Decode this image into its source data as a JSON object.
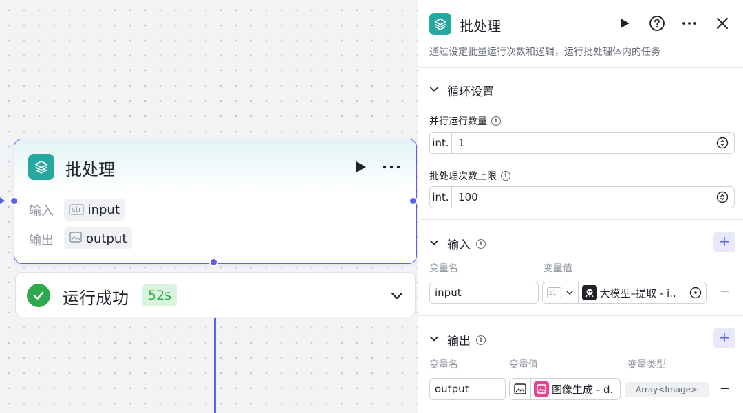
{
  "node": {
    "title": "批处理",
    "input_label": "输入",
    "input_type": "str",
    "input_value": "input",
    "output_label": "输出",
    "output_value": "output"
  },
  "status": {
    "text": "运行成功",
    "duration": "52s"
  },
  "panel": {
    "title": "批处理",
    "description": "通过设定批量运行次数和逻辑，运行批处理体内的任务",
    "loop_section": {
      "title": "循环设置",
      "parallel_label": "并行运行数量",
      "parallel_prefix": "int.",
      "parallel_value": "1",
      "limit_label": "批处理次数上限",
      "limit_prefix": "int.",
      "limit_value": "100"
    },
    "input_section": {
      "title": "输入",
      "add": "+",
      "col_name": "变量名",
      "col_value": "变量值",
      "row": {
        "name": "input",
        "type": "str",
        "ref": "大模型–提取 - i.."
      },
      "remove": "−"
    },
    "output_section": {
      "title": "输出",
      "add": "+",
      "col_name": "变量名",
      "col_value": "变量值",
      "col_type": "变量类型",
      "row": {
        "name": "output",
        "ref": "图像生成 - d.",
        "type": "Array<Image>"
      },
      "remove": "−"
    }
  },
  "colors": {
    "accent": "#5a63e8",
    "app_icon": "#26a7a0",
    "success": "#2ea94e",
    "image_tag": "#e84393"
  }
}
